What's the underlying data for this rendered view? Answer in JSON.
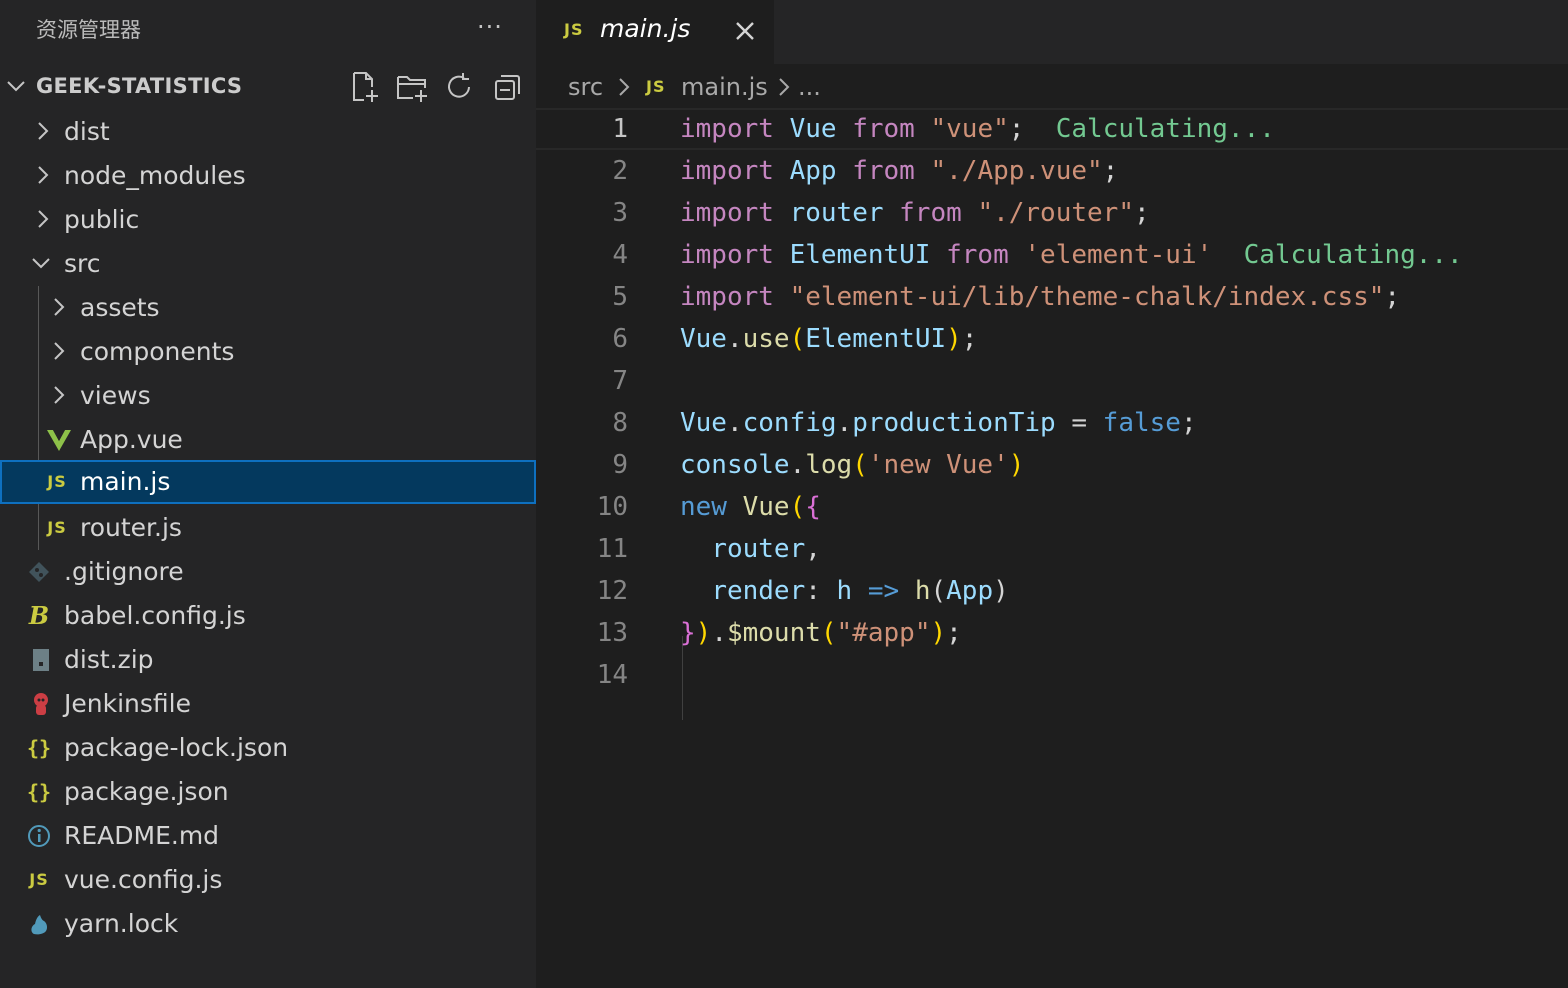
{
  "sidebar": {
    "title": "资源管理器",
    "more_icon": "ellipsis-icon",
    "project": "GEEK-STATISTICS",
    "toolbar": [
      "new-file-icon",
      "new-folder-icon",
      "refresh-icon",
      "collapse-all-icon"
    ],
    "tree": [
      {
        "label": "dist",
        "type": "folder",
        "expanded": false
      },
      {
        "label": "node_modules",
        "type": "folder",
        "expanded": false
      },
      {
        "label": "public",
        "type": "folder",
        "expanded": false
      },
      {
        "label": "src",
        "type": "folder",
        "expanded": true
      },
      {
        "label": "assets",
        "type": "folder",
        "expanded": false
      },
      {
        "label": "components",
        "type": "folder",
        "expanded": false
      },
      {
        "label": "views",
        "type": "folder",
        "expanded": false
      },
      {
        "label": "App.vue",
        "type": "file",
        "icon": "vue-icon"
      },
      {
        "label": "main.js",
        "type": "file",
        "icon": "js-icon",
        "selected": true
      },
      {
        "label": "router.js",
        "type": "file",
        "icon": "js-icon"
      },
      {
        "label": ".gitignore",
        "type": "file",
        "icon": "git-icon"
      },
      {
        "label": "babel.config.js",
        "type": "file",
        "icon": "babel-icon"
      },
      {
        "label": "dist.zip",
        "type": "file",
        "icon": "zip-icon"
      },
      {
        "label": "Jenkinsfile",
        "type": "file",
        "icon": "jenkins-icon"
      },
      {
        "label": "package-lock.json",
        "type": "file",
        "icon": "json-icon"
      },
      {
        "label": "package.json",
        "type": "file",
        "icon": "json-icon"
      },
      {
        "label": "README.md",
        "type": "file",
        "icon": "info-icon"
      },
      {
        "label": "vue.config.js",
        "type": "file",
        "icon": "js-icon"
      },
      {
        "label": "yarn.lock",
        "type": "file",
        "icon": "yarn-icon"
      }
    ],
    "js_badge": "JS",
    "json_badge": "{}"
  },
  "editor": {
    "tab": {
      "label": "main.js",
      "badge": "JS"
    },
    "breadcrumb": {
      "folder": "src",
      "file": "main.js",
      "tail": "...",
      "badge": "JS"
    },
    "current_line": 1,
    "hint_text": "Calculating...",
    "lines": [
      {
        "number": "1",
        "tokens": [
          [
            "kw",
            "import"
          ],
          [
            "punct",
            " "
          ],
          [
            "var",
            "Vue"
          ],
          [
            "punct",
            " "
          ],
          [
            "kw",
            "from"
          ],
          [
            "punct",
            " "
          ],
          [
            "str",
            "\"vue\""
          ],
          [
            "punct",
            ";  "
          ],
          [
            "hint",
            "Calculating..."
          ]
        ]
      },
      {
        "number": "2",
        "tokens": [
          [
            "kw",
            "import"
          ],
          [
            "punct",
            " "
          ],
          [
            "var",
            "App"
          ],
          [
            "punct",
            " "
          ],
          [
            "kw",
            "from"
          ],
          [
            "punct",
            " "
          ],
          [
            "str",
            "\"./App.vue\""
          ],
          [
            "punct",
            ";"
          ]
        ]
      },
      {
        "number": "3",
        "tokens": [
          [
            "kw",
            "import"
          ],
          [
            "punct",
            " "
          ],
          [
            "var",
            "router"
          ],
          [
            "punct",
            " "
          ],
          [
            "kw",
            "from"
          ],
          [
            "punct",
            " "
          ],
          [
            "str",
            "\"./router\""
          ],
          [
            "punct",
            ";"
          ]
        ]
      },
      {
        "number": "4",
        "tokens": [
          [
            "kw",
            "import"
          ],
          [
            "punct",
            " "
          ],
          [
            "var",
            "ElementUI"
          ],
          [
            "punct",
            " "
          ],
          [
            "kw",
            "from"
          ],
          [
            "punct",
            " "
          ],
          [
            "str",
            "'element-ui'"
          ],
          [
            "punct",
            "  "
          ],
          [
            "hint",
            "Calculating..."
          ]
        ]
      },
      {
        "number": "5",
        "tokens": [
          [
            "kw",
            "import"
          ],
          [
            "punct",
            " "
          ],
          [
            "str",
            "\"element-ui/lib/theme-chalk/index.css\""
          ],
          [
            "punct",
            ";"
          ]
        ]
      },
      {
        "number": "6",
        "tokens": [
          [
            "var",
            "Vue"
          ],
          [
            "punct",
            "."
          ],
          [
            "fn",
            "use"
          ],
          [
            "brk1",
            "("
          ],
          [
            "var",
            "ElementUI"
          ],
          [
            "brk1",
            ")"
          ],
          [
            "punct",
            ";"
          ]
        ]
      },
      {
        "number": "7",
        "tokens": []
      },
      {
        "number": "8",
        "tokens": [
          [
            "var",
            "Vue"
          ],
          [
            "punct",
            "."
          ],
          [
            "var",
            "config"
          ],
          [
            "punct",
            "."
          ],
          [
            "var",
            "productionTip"
          ],
          [
            "punct",
            " = "
          ],
          [
            "kwb",
            "false"
          ],
          [
            "punct",
            ";"
          ]
        ]
      },
      {
        "number": "9",
        "tokens": [
          [
            "var",
            "console"
          ],
          [
            "punct",
            "."
          ],
          [
            "fn",
            "log"
          ],
          [
            "brk1",
            "("
          ],
          [
            "str",
            "'new Vue'"
          ],
          [
            "brk1",
            ")"
          ]
        ]
      },
      {
        "number": "10",
        "tokens": [
          [
            "kwb",
            "new"
          ],
          [
            "punct",
            " "
          ],
          [
            "fn",
            "Vue"
          ],
          [
            "brk1",
            "("
          ],
          [
            "brk2",
            "{"
          ]
        ]
      },
      {
        "number": "11",
        "tokens": [
          [
            "punct",
            "  "
          ],
          [
            "var",
            "router"
          ],
          [
            "punct",
            ","
          ]
        ]
      },
      {
        "number": "12",
        "tokens": [
          [
            "punct",
            "  "
          ],
          [
            "var",
            "render"
          ],
          [
            "punct",
            ": "
          ],
          [
            "var",
            "h"
          ],
          [
            "punct",
            " "
          ],
          [
            "kwb",
            "=>"
          ],
          [
            "punct",
            " "
          ],
          [
            "fn",
            "h"
          ],
          [
            "punct",
            "("
          ],
          [
            "var",
            "App"
          ],
          [
            "punct",
            ")"
          ]
        ]
      },
      {
        "number": "13",
        "tokens": [
          [
            "brk2",
            "}"
          ],
          [
            "brk1",
            ")"
          ],
          [
            "punct",
            "."
          ],
          [
            "fn",
            "$mount"
          ],
          [
            "brk1",
            "("
          ],
          [
            "str",
            "\"#app\""
          ],
          [
            "brk1",
            ")"
          ],
          [
            "punct",
            ";"
          ]
        ]
      },
      {
        "number": "14",
        "tokens": []
      }
    ]
  },
  "colors": {
    "selection_bg": "#04395e",
    "selection_border": "#0e70c0",
    "js_icon": "#cbcb41",
    "keyword": "#c586c0",
    "string": "#ce9178",
    "variable": "#9cdcfe",
    "function": "#dcdcaa",
    "hint": "#73c991"
  }
}
